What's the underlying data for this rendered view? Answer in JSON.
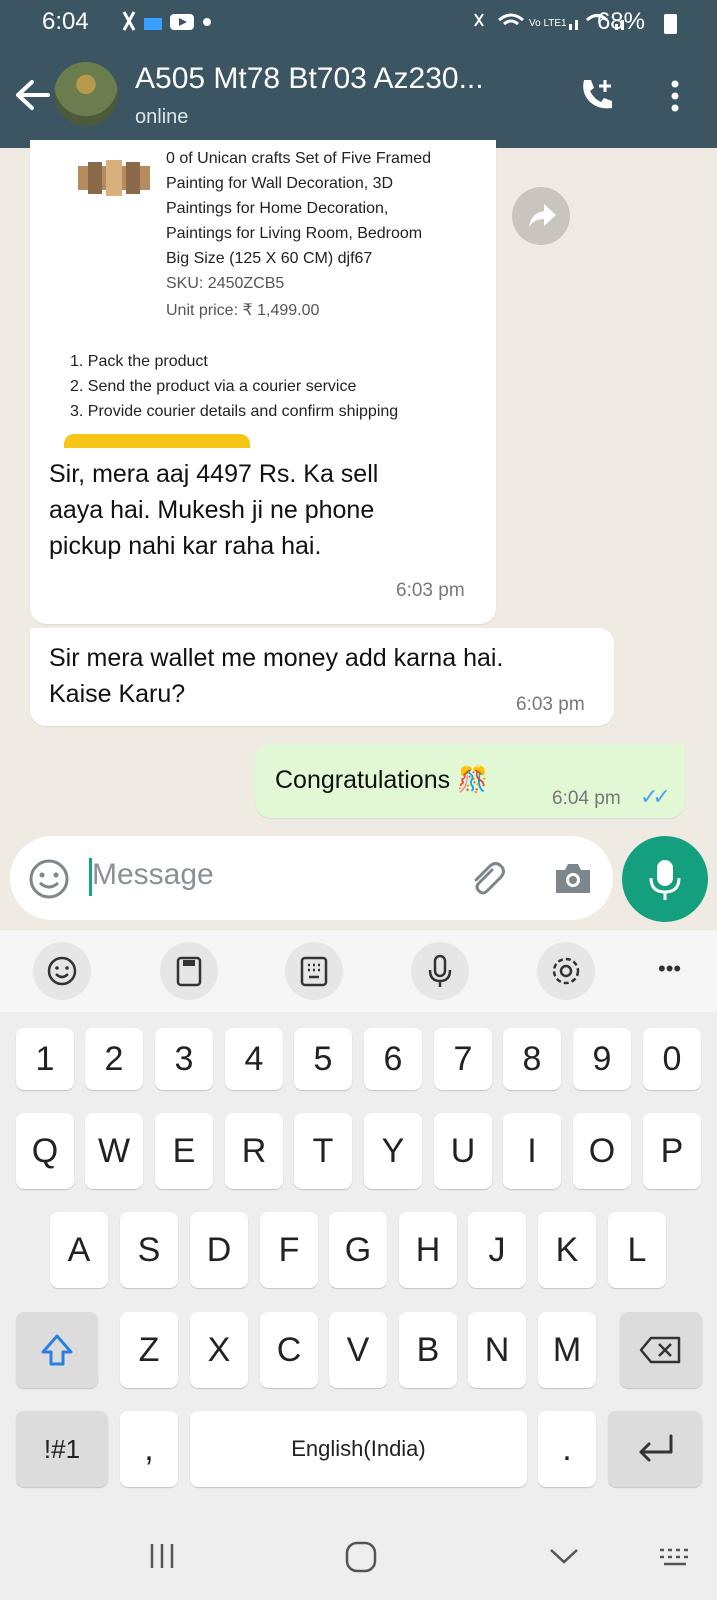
{
  "status_bar": {
    "time": "6:04",
    "battery": "68%"
  },
  "header": {
    "title": "A505 Mt78 Bt703 Az230...",
    "subtitle": "online"
  },
  "messages": {
    "product_card": {
      "lines": [
        "0 of Unican crafts Set of Five Framed",
        "Painting for Wall Decoration, 3D",
        "Paintings for Home Decoration,",
        "Paintings for Living Room, Bedroom",
        "Big Size (125 X 60 CM) djf67",
        "SKU: 2450ZCB5",
        "Unit price: ₹ 1,499.00"
      ],
      "steps": [
        "1. Pack the product",
        "2. Send the product via a courier service",
        "3. Provide courier details and confirm shipping"
      ]
    },
    "m1": {
      "lines": [
        "Sir, mera aaj 4497 Rs. Ka sell",
        "aaya hai. Mukesh ji ne phone",
        "pickup nahi kar raha hai."
      ],
      "time": "6:03 pm"
    },
    "m2": {
      "lines": [
        "Sir mera wallet me money add karna hai.",
        "Kaise Karu?"
      ],
      "time": "6:03 pm"
    },
    "m3": {
      "text": "Congratulations 🎊",
      "time": "6:04 pm",
      "ticks": "✓✓"
    }
  },
  "composer": {
    "placeholder": "Message"
  },
  "keyboard": {
    "row_numbers": [
      "1",
      "2",
      "3",
      "4",
      "5",
      "6",
      "7",
      "8",
      "9",
      "0"
    ],
    "row1": [
      "Q",
      "W",
      "E",
      "R",
      "T",
      "Y",
      "U",
      "I",
      "O",
      "P"
    ],
    "row2": [
      "A",
      "S",
      "D",
      "F",
      "G",
      "H",
      "J",
      "K",
      "L"
    ],
    "row3": [
      "Z",
      "X",
      "C",
      "V",
      "B",
      "N",
      "M"
    ],
    "symbols": "!#1",
    "comma": ",",
    "space": "English(India)",
    "period": ".",
    "more": "•••"
  },
  "colors": {
    "header": "#3b5563",
    "accent": "#14a07f",
    "out_bubble": "#e2f8d5",
    "chat_bg": "#efeae2"
  }
}
